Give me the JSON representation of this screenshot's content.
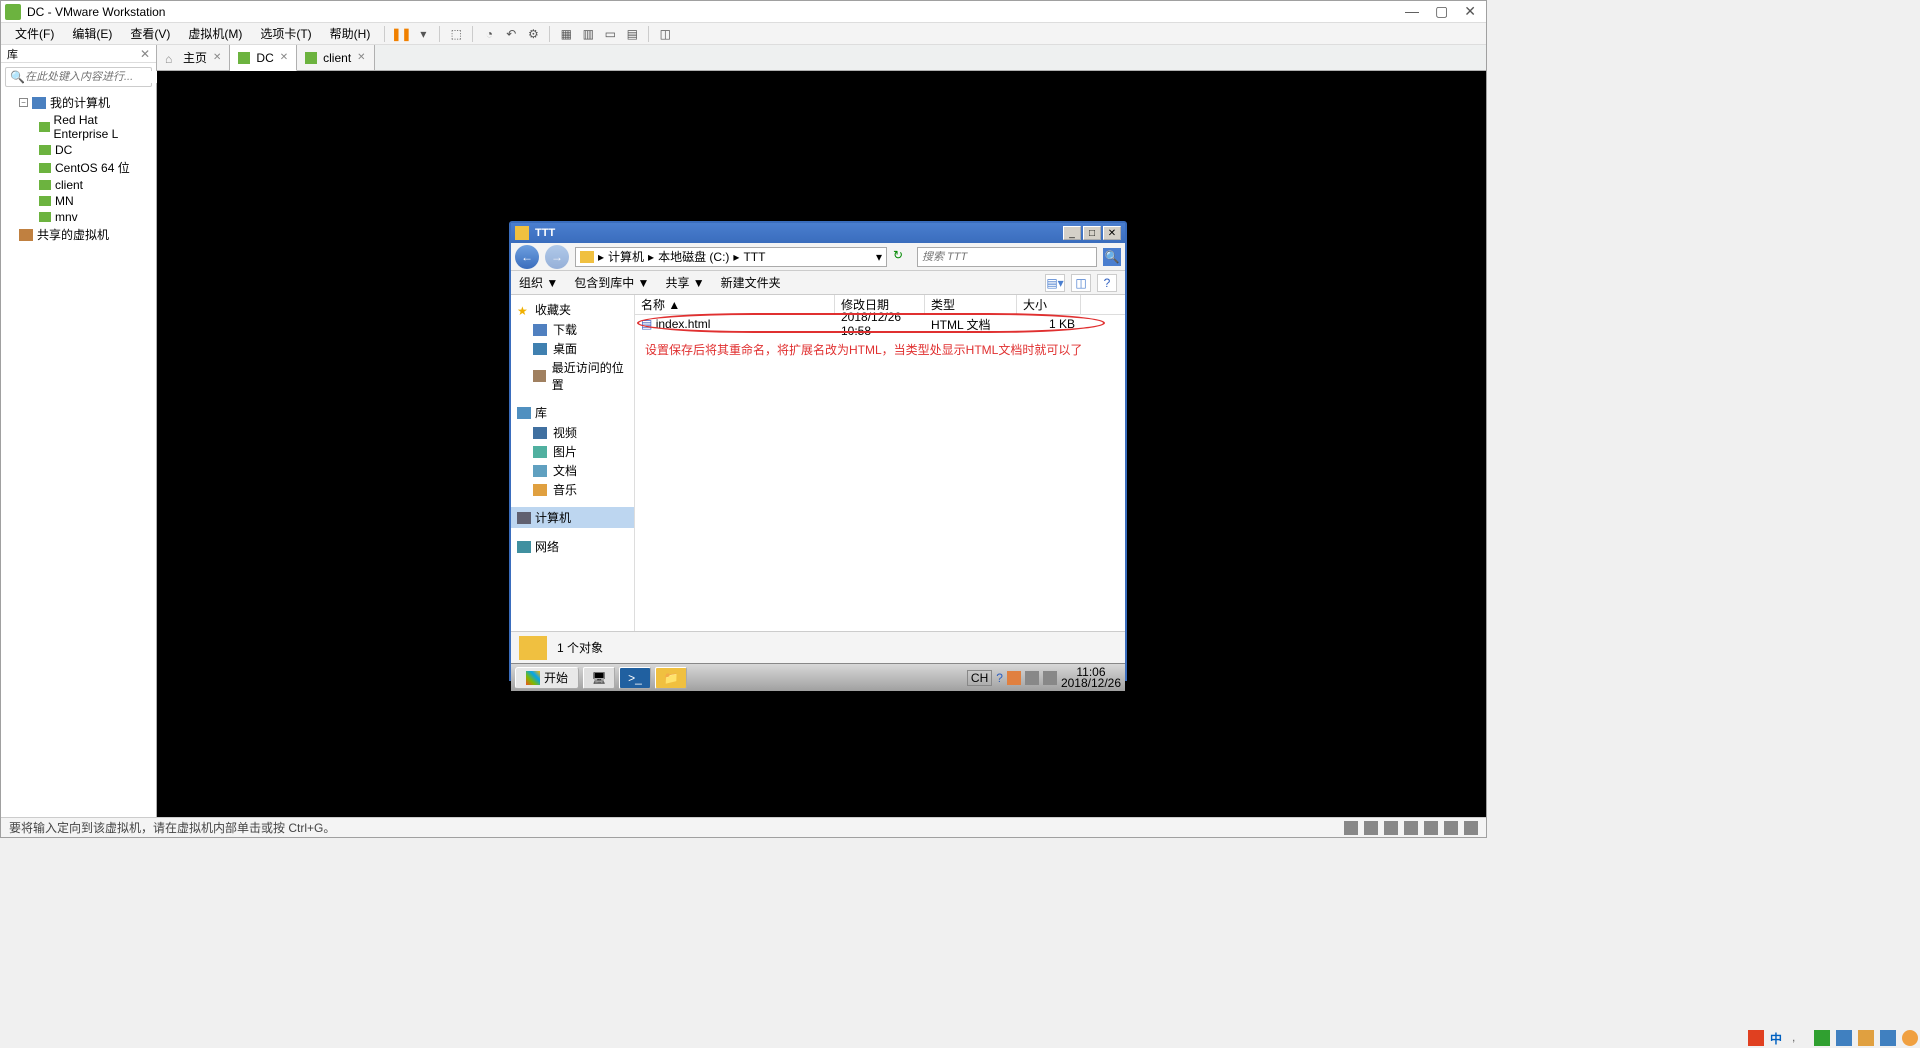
{
  "app": {
    "title": "DC - VMware Workstation"
  },
  "menubar": {
    "file": "文件(F)",
    "edit": "编辑(E)",
    "view": "查看(V)",
    "vm": "虚拟机(M)",
    "tabs": "选项卡(T)",
    "help": "帮助(H)"
  },
  "sidebar": {
    "lib_label": "库",
    "search_placeholder": "在此处键入内容进行...",
    "root": "我的计算机",
    "nodes": {
      "rhel": "Red Hat Enterprise L",
      "dc": "DC",
      "centos": "CentOS 64 位",
      "client": "client",
      "mn": "MN",
      "mnv": "mnv"
    },
    "shared": "共享的虚拟机"
  },
  "tabs": {
    "home": "主页",
    "dc": "DC",
    "client": "client"
  },
  "explorer": {
    "title": "TTT",
    "breadcrumb": {
      "computer": "计算机",
      "disk": "本地磁盘 (C:)",
      "folder": "TTT"
    },
    "search_placeholder": "搜索 TTT",
    "toolbar": {
      "organize": "组织 ▼",
      "include": "包含到库中 ▼",
      "share": "共享 ▼",
      "newfolder": "新建文件夹"
    },
    "nav": {
      "favorites": "收藏夹",
      "downloads": "下载",
      "desktop": "桌面",
      "recent": "最近访问的位置",
      "library": "库",
      "videos": "视频",
      "pictures": "图片",
      "documents": "文档",
      "music": "音乐",
      "computer": "计算机",
      "network": "网络"
    },
    "columns": {
      "name": "名称 ▲",
      "date": "修改日期",
      "type": "类型",
      "size": "大小"
    },
    "file": {
      "name": "index.html",
      "date": "2018/12/26 10:58",
      "type": "HTML 文档",
      "size": "1 KB"
    },
    "annotation": "设置保存后将其重命名，将扩展名改为HTML，当类型处显示HTML文档时就可以了",
    "status": "1 个对象",
    "taskbar": {
      "start": "开始",
      "lang": "CH",
      "time": "11:06",
      "date": "2018/12/26"
    }
  },
  "vm_status": {
    "hint": "要将输入定向到该虚拟机，请在虚拟机内部单击或按 Ctrl+G。"
  },
  "host_tray": {
    "cn": "中"
  }
}
